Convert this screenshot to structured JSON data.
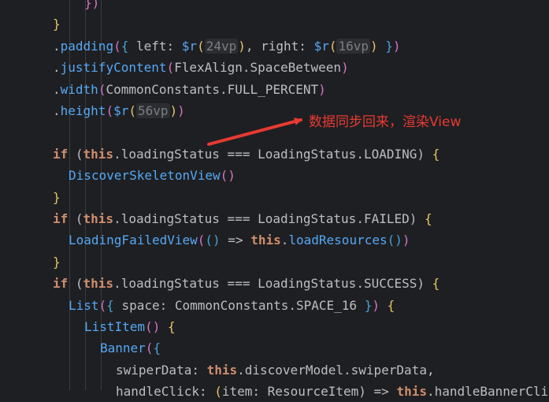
{
  "editor": {
    "lines": [
      {
        "indent": 8,
        "tokens": [
          {
            "t": "})",
            "c": "br2"
          }
        ]
      },
      {
        "indent": 4,
        "tokens": [
          {
            "t": "}",
            "c": "br1"
          }
        ]
      },
      {
        "indent": 4,
        "tokens": [
          {
            "t": ".",
            "c": "punc"
          },
          {
            "t": "padding",
            "c": "fn"
          },
          {
            "t": "(",
            "c": "br2"
          },
          {
            "t": "{",
            "c": "br3"
          },
          {
            "t": " left: ",
            "c": "text"
          },
          {
            "t": "$r",
            "c": "sfn"
          },
          {
            "t": "(",
            "c": "br1"
          },
          {
            "t": "24vp",
            "c": "hint"
          },
          {
            "t": ")",
            "c": "br1"
          },
          {
            "t": ", right: ",
            "c": "text"
          },
          {
            "t": "$r",
            "c": "sfn"
          },
          {
            "t": "(",
            "c": "br1"
          },
          {
            "t": "16vp",
            "c": "hint"
          },
          {
            "t": ")",
            "c": "br1"
          },
          {
            "t": " }",
            "c": "br3"
          },
          {
            "t": ")",
            "c": "br2"
          }
        ]
      },
      {
        "indent": 4,
        "tokens": [
          {
            "t": ".",
            "c": "punc"
          },
          {
            "t": "justifyContent",
            "c": "fn"
          },
          {
            "t": "(",
            "c": "br2"
          },
          {
            "t": "FlexAlign.SpaceBetween",
            "c": "text"
          },
          {
            "t": ")",
            "c": "br2"
          }
        ]
      },
      {
        "indent": 4,
        "tokens": [
          {
            "t": ".",
            "c": "punc"
          },
          {
            "t": "width",
            "c": "fn"
          },
          {
            "t": "(",
            "c": "br2"
          },
          {
            "t": "CommonConstants.FULL_PERCENT",
            "c": "text"
          },
          {
            "t": ")",
            "c": "br2"
          }
        ]
      },
      {
        "indent": 4,
        "tokens": [
          {
            "t": ".",
            "c": "punc"
          },
          {
            "t": "height",
            "c": "fn"
          },
          {
            "t": "(",
            "c": "br2"
          },
          {
            "t": "$r",
            "c": "sfn"
          },
          {
            "t": "(",
            "c": "br1"
          },
          {
            "t": "56vp",
            "c": "hint"
          },
          {
            "t": ")",
            "c": "br1"
          },
          {
            "t": ")",
            "c": "br2"
          }
        ]
      },
      {
        "indent": 4,
        "tokens": []
      },
      {
        "indent": 4,
        "tokens": [
          {
            "t": "if",
            "c": "kw"
          },
          {
            "t": " (",
            "c": "text"
          },
          {
            "t": "this",
            "c": "kw"
          },
          {
            "t": ".loadingStatus === LoadingStatus.LOADING) ",
            "c": "text"
          },
          {
            "t": "{",
            "c": "br1"
          }
        ]
      },
      {
        "indent": 6,
        "tokens": [
          {
            "t": "DiscoverSkeletonView",
            "c": "comp"
          },
          {
            "t": "()",
            "c": "br2"
          }
        ]
      },
      {
        "indent": 4,
        "tokens": [
          {
            "t": "}",
            "c": "br1"
          }
        ]
      },
      {
        "indent": 4,
        "tokens": [
          {
            "t": "if",
            "c": "kw"
          },
          {
            "t": " (",
            "c": "text"
          },
          {
            "t": "this",
            "c": "kw"
          },
          {
            "t": ".loadingStatus === LoadingStatus.FAILED) ",
            "c": "text"
          },
          {
            "t": "{",
            "c": "br1"
          }
        ]
      },
      {
        "indent": 6,
        "tokens": [
          {
            "t": "LoadingFailedView",
            "c": "comp"
          },
          {
            "t": "(",
            "c": "br2"
          },
          {
            "t": "()",
            "c": "br3"
          },
          {
            "t": " => ",
            "c": "text"
          },
          {
            "t": "this",
            "c": "kw"
          },
          {
            "t": ".",
            "c": "text"
          },
          {
            "t": "loadResources",
            "c": "fn"
          },
          {
            "t": "()",
            "c": "br3"
          },
          {
            "t": ")",
            "c": "br2"
          }
        ]
      },
      {
        "indent": 4,
        "tokens": [
          {
            "t": "}",
            "c": "br1"
          }
        ]
      },
      {
        "indent": 4,
        "tokens": [
          {
            "t": "if",
            "c": "kw"
          },
          {
            "t": " (",
            "c": "text"
          },
          {
            "t": "this",
            "c": "kw"
          },
          {
            "t": ".loadingStatus === LoadingStatus.SUCCESS) ",
            "c": "text"
          },
          {
            "t": "{",
            "c": "br1"
          }
        ]
      },
      {
        "indent": 6,
        "tokens": [
          {
            "t": "List",
            "c": "comp"
          },
          {
            "t": "(",
            "c": "br2"
          },
          {
            "t": "{",
            "c": "br3"
          },
          {
            "t": " space: CommonConstants.SPACE_16 ",
            "c": "text"
          },
          {
            "t": "}",
            "c": "br3"
          },
          {
            "t": ")",
            "c": "br2"
          },
          {
            "t": " {",
            "c": "br1"
          }
        ]
      },
      {
        "indent": 8,
        "tokens": [
          {
            "t": "ListItem",
            "c": "comp"
          },
          {
            "t": "()",
            "c": "br2"
          },
          {
            "t": " {",
            "c": "br1"
          }
        ]
      },
      {
        "indent": 10,
        "tokens": [
          {
            "t": "Banner",
            "c": "comp"
          },
          {
            "t": "(",
            "c": "br2"
          },
          {
            "t": "{",
            "c": "br3"
          }
        ]
      },
      {
        "indent": 12,
        "tokens": [
          {
            "t": "swiperData",
            "c": "text"
          },
          {
            "t": ": ",
            "c": "text"
          },
          {
            "t": "this",
            "c": "kw"
          },
          {
            "t": ".discoverModel.swiperData,",
            "c": "text"
          }
        ]
      },
      {
        "indent": 12,
        "tokens": [
          {
            "t": "handleClick",
            "c": "text"
          },
          {
            "t": ": ",
            "c": "text"
          },
          {
            "t": "(",
            "c": "br1"
          },
          {
            "t": "item: ",
            "c": "text"
          },
          {
            "t": "ResourceItem",
            "c": "text"
          },
          {
            "t": ") => ",
            "c": "text"
          },
          {
            "t": "this",
            "c": "kw"
          },
          {
            "t": ".handleBannerClick",
            "c": "text"
          }
        ]
      }
    ]
  },
  "annotation": {
    "label": "数据同步回来，渲染View",
    "color": "#e83a32"
  }
}
